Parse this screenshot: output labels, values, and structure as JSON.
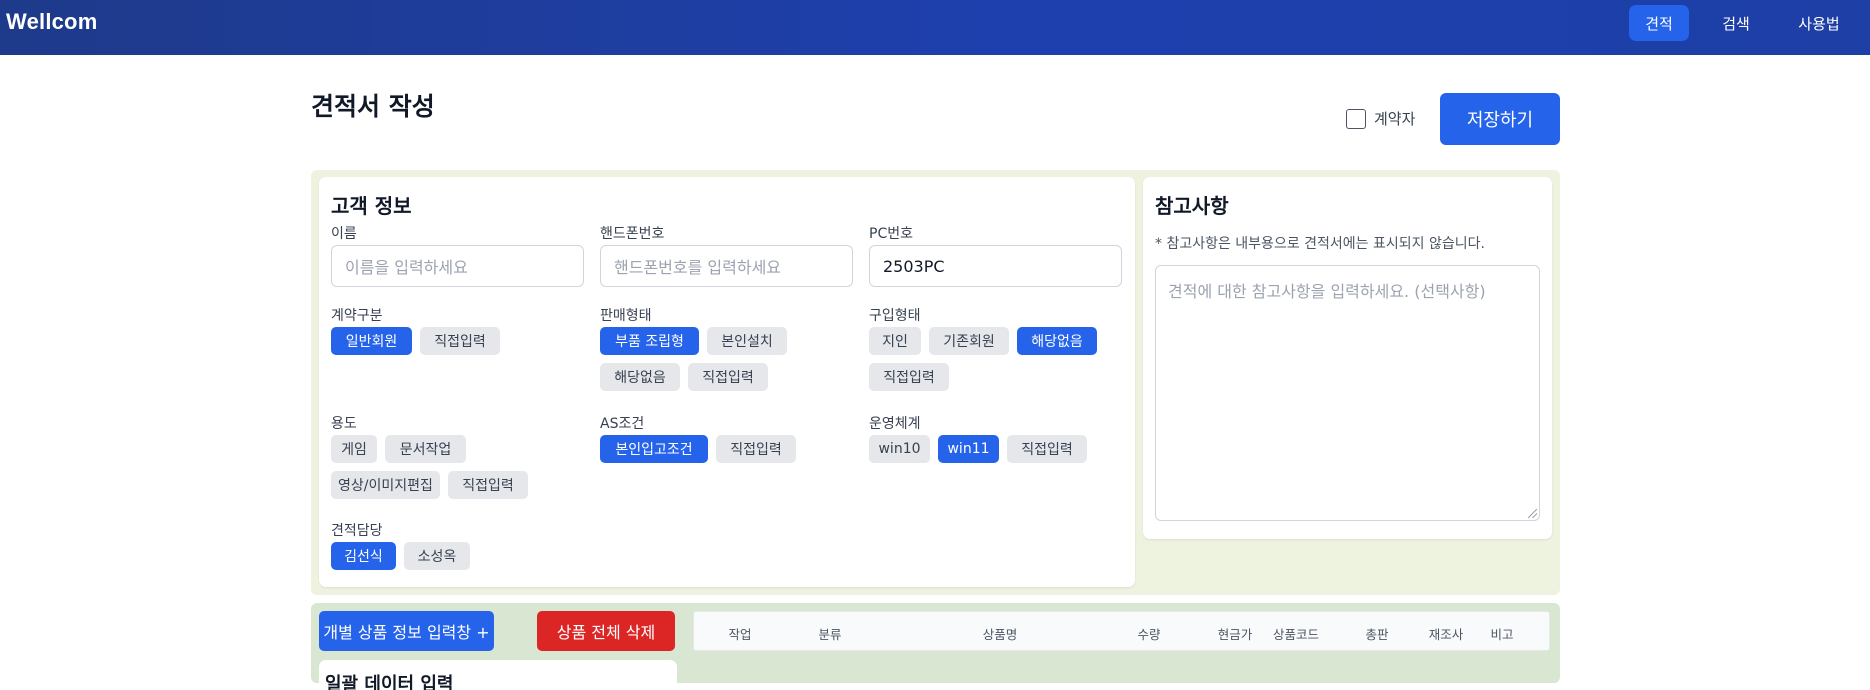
{
  "nav": {
    "brand": "Wellcom",
    "items": [
      "견적",
      "검색",
      "사용법"
    ],
    "active": "견적"
  },
  "header": {
    "title": "견적서 작성",
    "contract_label": "계약자",
    "contract_checked": false,
    "save_label": "저장하기"
  },
  "customer": {
    "title": "고객 정보",
    "name_label": "이름",
    "name_placeholder": "이름을 입력하세요",
    "phone_label": "핸드폰번호",
    "phone_placeholder": "핸드폰번호를 입력하세요",
    "pc_label": "PC번호",
    "pc_value": "2503PC",
    "contract_type": {
      "label": "계약구분",
      "options": [
        "일반회원",
        "직접입력"
      ],
      "selected": "일반회원"
    },
    "sale_type": {
      "label": "판매형태",
      "options": [
        "부품 조립형",
        "본인설치",
        "해당없음",
        "직접입력"
      ],
      "selected": "부품 조립형"
    },
    "purchase_type": {
      "label": "구입형태",
      "options": [
        "지인",
        "기존회원",
        "해당없음",
        "직접입력"
      ],
      "selected": "해당없음"
    },
    "usage": {
      "label": "용도",
      "options": [
        "게임",
        "문서작업",
        "영상/이미지편집",
        "직접입력"
      ],
      "selected": ""
    },
    "as_condition": {
      "label": "AS조건",
      "options": [
        "본인입고조건",
        "직접입력"
      ],
      "selected": "본인입고조건"
    },
    "os": {
      "label": "운영체계",
      "options": [
        "win10",
        "win11",
        "직접입력"
      ],
      "selected": "win11"
    },
    "manager": {
      "label": "견적담당",
      "options": [
        "김선식",
        "소성옥"
      ],
      "selected": "김선식"
    }
  },
  "notes": {
    "title": "참고사항",
    "hint": "* 참고사항은 내부용으로 견적서에는 표시되지 않습니다.",
    "placeholder": "견적에 대한 참고사항을 입력하세요. (선택사항)"
  },
  "products": {
    "add_button": "개별 상품 정보 입력창 +",
    "delete_all_button": "상품 전체 삭제",
    "columns": [
      "작업",
      "분류",
      "상품명",
      "수량",
      "현금가",
      "상품코드",
      "총판",
      "재조사",
      "비고"
    ],
    "peek_title": "일괄 데이터 입력"
  },
  "colors": {
    "nav": "#1e40af",
    "primary": "#2563eb",
    "danger": "#dc2626",
    "section_bg": "#eef3e0"
  }
}
